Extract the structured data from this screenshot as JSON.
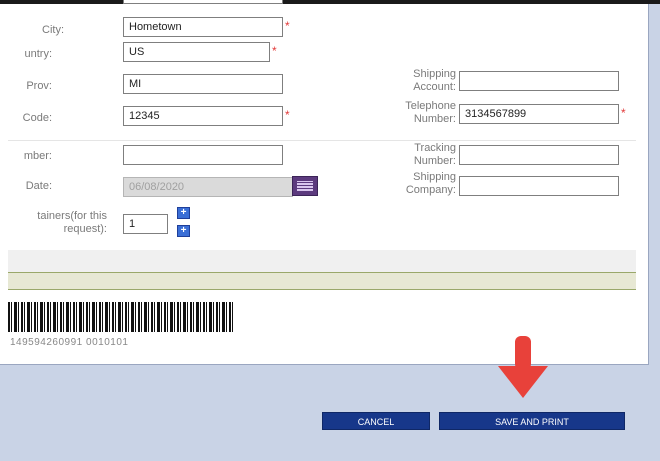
{
  "form": {
    "city": {
      "label": "City:",
      "value": "Hometown"
    },
    "country": {
      "label": "untry:",
      "value": "US"
    },
    "prov": {
      "label": "Prov:",
      "value": "MI"
    },
    "code": {
      "label": "Code:",
      "value": "12345"
    },
    "number": {
      "label": "mber:",
      "value": ""
    },
    "date": {
      "label": "Date:",
      "value": "06/08/2020"
    },
    "containers": {
      "label_line1": "tainers(for this",
      "label_line2": "request):",
      "value": "1"
    },
    "shipping_account": {
      "label_line1": "Shipping",
      "label_line2": "Account:",
      "value": ""
    },
    "telephone": {
      "label_line1": "Telephone",
      "label_line2": "Number:",
      "value": "3134567899"
    },
    "tracking": {
      "label_line1": "Tracking",
      "label_line2": "Number:",
      "value": ""
    },
    "shipping_company": {
      "label_line1": "Shipping",
      "label_line2": "Company:",
      "value": ""
    },
    "required_mark": "*"
  },
  "barcode": {
    "text": "149594260991 0010101"
  },
  "buttons": {
    "cancel": "CANCEL",
    "save_print": "SAVE AND PRINT"
  },
  "icons": {
    "calendar": "calendar-icon",
    "plus": "plus-icon",
    "arrow": "arrow-down-icon"
  },
  "colors": {
    "button_bg": "#17378a",
    "required": "#e23a3a",
    "arrow": "#e8413a"
  }
}
